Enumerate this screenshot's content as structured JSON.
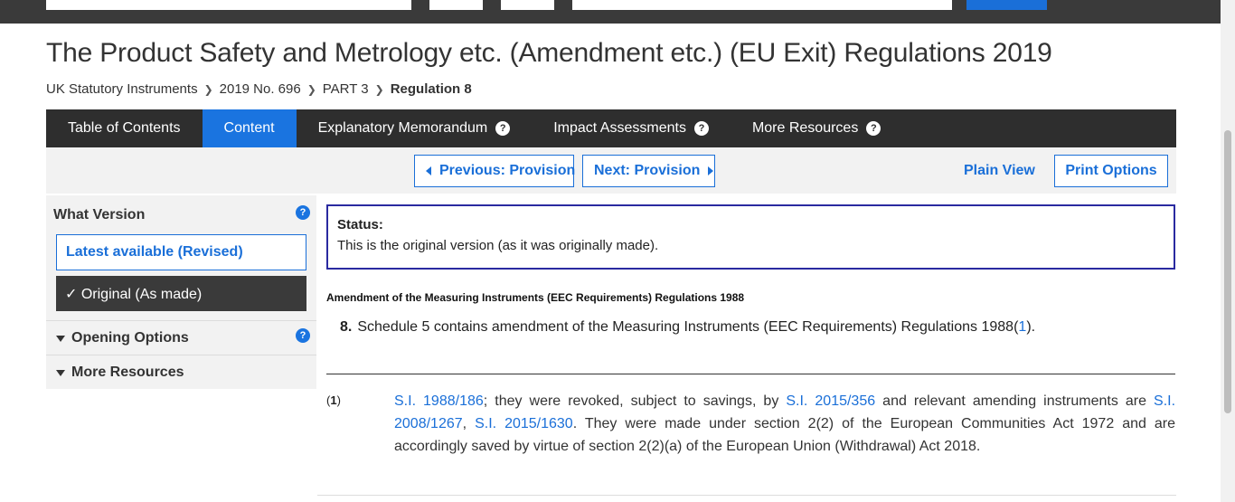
{
  "page": {
    "title": "The Product Safety and Metrology etc. (Amendment etc.) (EU Exit) Regulations 2019"
  },
  "breadcrumb": {
    "items": [
      "UK Statutory Instruments",
      "2019 No. 696",
      "PART 3"
    ],
    "current": "Regulation 8"
  },
  "tabs": [
    {
      "label": "Table of Contents",
      "help": false,
      "active": false
    },
    {
      "label": "Content",
      "help": false,
      "active": true
    },
    {
      "label": "Explanatory Memorandum",
      "help": true,
      "active": false
    },
    {
      "label": "Impact Assessments",
      "help": true,
      "active": false
    },
    {
      "label": "More Resources",
      "help": true,
      "active": false
    }
  ],
  "nav": {
    "previous_label": "Previous: Provision",
    "next_label": "Next: Provision",
    "plain_view_label": "Plain View",
    "print_options_label": "Print Options"
  },
  "sidebar": {
    "what_version_label": "What Version",
    "latest_label": "Latest available (Revised)",
    "original_label": "✓ Original (As made)",
    "opening_options_label": "Opening Options",
    "more_resources_label": "More Resources"
  },
  "status": {
    "label": "Status:",
    "text": "This is the original version (as it was originally made)."
  },
  "content": {
    "heading": "Amendment of the Measuring Instruments (EEC Requirements) Regulations 1988",
    "provision_number": "8.",
    "provision_text": "Schedule 5 contains amendment of the Measuring Instruments (EEC Requirements) Regulations 1988(",
    "provision_ref": "1",
    "provision_close": ")."
  },
  "footnote": {
    "number": "1",
    "link1": "S.I. 1988/186",
    "text1": "; they were revoked, subject to savings, by ",
    "link2": "S.I. 2015/356",
    "text2": " and relevant amending instruments are ",
    "link3": "S.I. 2008/1267",
    "text3": ", ",
    "link4": "S.I. 2015/1630",
    "text4": ". They were made under section 2(2) of the European Communities Act 1972 and are accordingly saved by virtue of section 2(2)(a) of the European Union (Withdrawal) Act 2018."
  },
  "colors": {
    "accent": "#1a74e0",
    "tabbar": "#2e2e2e",
    "status_border": "#2a2aa0"
  }
}
